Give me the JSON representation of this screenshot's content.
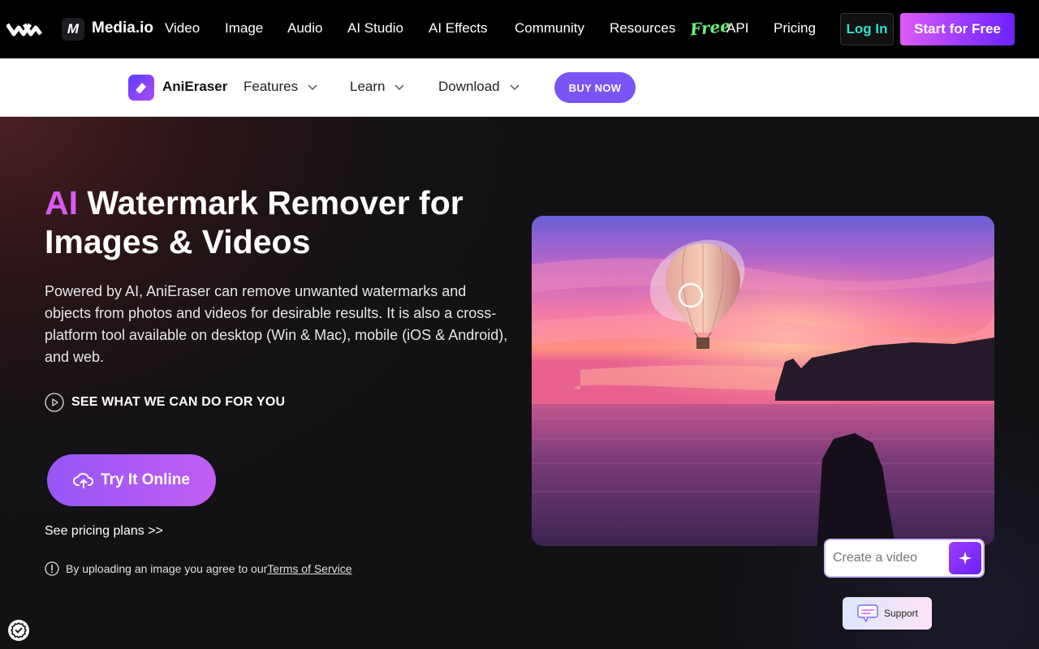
{
  "topnav": {
    "brand": "Media.io",
    "brand_logo_letter": "M",
    "items": [
      "Video",
      "Image",
      "Audio",
      "AI Studio",
      "AI Effects",
      "Community",
      "Resources",
      "API",
      "Pricing"
    ],
    "free_badge": "Free",
    "login_label": "Log In",
    "start_label": "Start for Free"
  },
  "subnav": {
    "product_name": "AniEraser",
    "items": [
      "Features",
      "Learn",
      "Download"
    ],
    "buy_label": "BUY NOW"
  },
  "hero": {
    "title_accent": "AI",
    "title_rest": " Watermark Remover for Images & Videos",
    "description": "Powered by AI, AniEraser can remove unwanted watermarks and objects from photos and videos for desirable results. It is also a cross-platform tool available on desktop (Win & Mac), mobile (iOS & Android), and web.",
    "see_what_label": "SEE WHAT WE CAN DO FOR YOU",
    "try_label": "Try It Online",
    "pricing_link": "See pricing plans >>",
    "tos_prefix": "By uploading an image you agree to our ",
    "tos_link": "Terms of Service"
  },
  "widget": {
    "create_placeholder": "Create a video",
    "support_label": "Support"
  },
  "colors": {
    "accent_purple": "#7a55f5",
    "accent_pink": "#d85af0",
    "login_teal": "#2ee0c8",
    "free_green": "#6ff07a"
  }
}
